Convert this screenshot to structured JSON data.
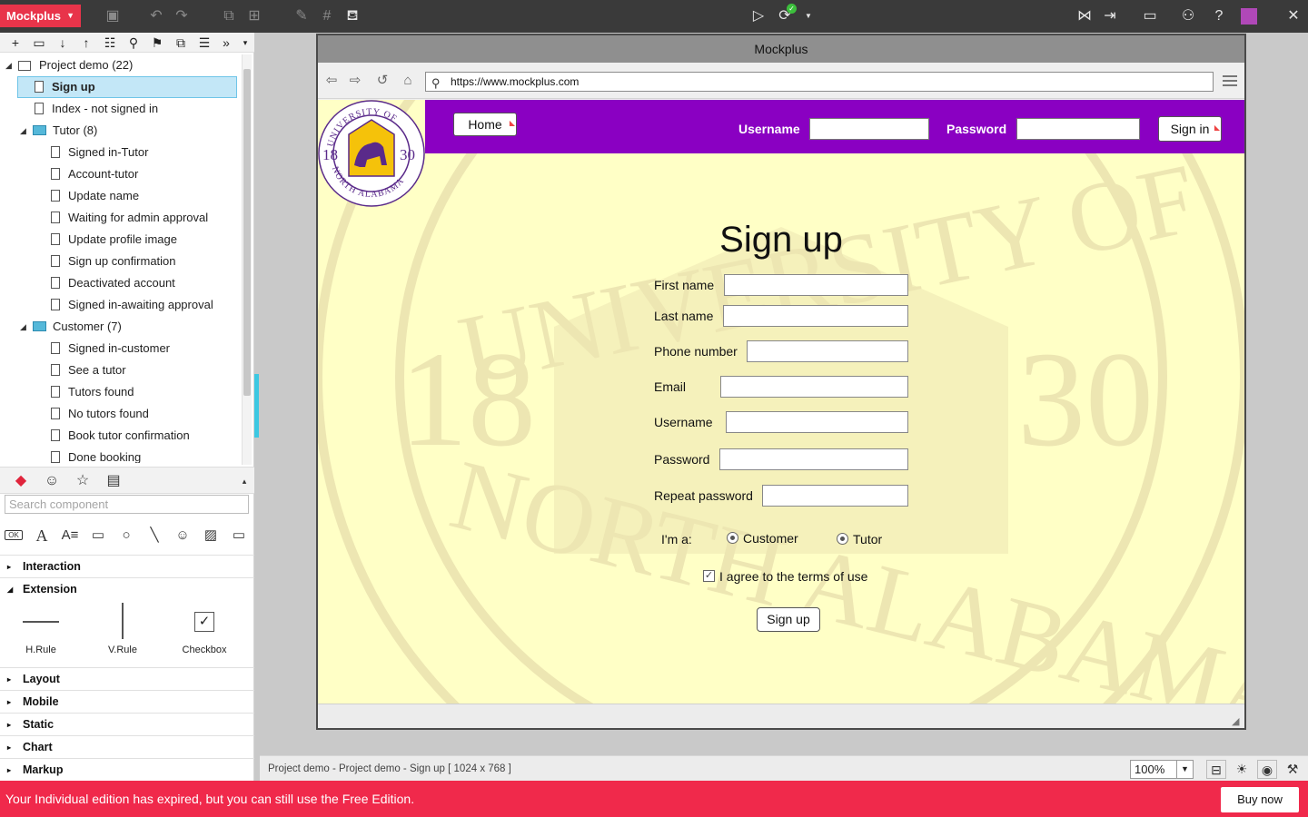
{
  "app": {
    "name": "Mockplus"
  },
  "tree": {
    "items": [
      {
        "label": "Project demo (22)",
        "kind": "project",
        "level": 0
      },
      {
        "label": "Sign up",
        "kind": "page",
        "level": 1,
        "selected": true
      },
      {
        "label": "Index - not signed in",
        "kind": "page",
        "level": 1
      },
      {
        "label": "Tutor (8)",
        "kind": "folder",
        "level": 1
      },
      {
        "label": "Signed in-Tutor",
        "kind": "page",
        "level": 2
      },
      {
        "label": "Account-tutor",
        "kind": "page",
        "level": 2
      },
      {
        "label": "Update name",
        "kind": "page",
        "level": 2
      },
      {
        "label": "Waiting for admin approval",
        "kind": "page",
        "level": 2
      },
      {
        "label": "Update profile image",
        "kind": "page",
        "level": 2
      },
      {
        "label": "Sign up confirmation",
        "kind": "page",
        "level": 2
      },
      {
        "label": "Deactivated account",
        "kind": "page",
        "level": 2
      },
      {
        "label": "Signed in-awaiting approval",
        "kind": "page",
        "level": 2
      },
      {
        "label": "Customer (7)",
        "kind": "folder",
        "level": 1
      },
      {
        "label": "Signed in-customer",
        "kind": "page",
        "level": 2
      },
      {
        "label": "See a tutor",
        "kind": "page",
        "level": 2
      },
      {
        "label": "Tutors found",
        "kind": "page",
        "level": 2
      },
      {
        "label": "No tutors found",
        "kind": "page",
        "level": 2
      },
      {
        "label": "Book tutor confirmation",
        "kind": "page",
        "level": 2
      },
      {
        "label": "Done booking",
        "kind": "page",
        "level": 2
      }
    ]
  },
  "components": {
    "search_placeholder": "Search component",
    "categories": {
      "interaction": "Interaction",
      "extension": "Extension",
      "layout": "Layout",
      "mobile": "Mobile",
      "static": "Static",
      "chart": "Chart",
      "markup": "Markup"
    },
    "extension_items": [
      "H.Rule",
      "V.Rule",
      "Checkbox"
    ]
  },
  "browser": {
    "title": "Mockplus",
    "url": "https://www.mockplus.com"
  },
  "page": {
    "home_label": "Home",
    "username_label": "Username",
    "password_label": "Password",
    "signin_label": "Sign in",
    "title": "Sign up",
    "fields": {
      "first_name": "First name",
      "last_name": "Last name",
      "phone": "Phone number",
      "email": "Email",
      "username": "Username",
      "password": "Password",
      "repeat_password": "Repeat password"
    },
    "role_label": "I'm a:",
    "role_options": [
      "Customer",
      "Tutor"
    ],
    "terms_label": "I agree to the terms of use",
    "submit_label": "Sign up",
    "logo": {
      "top": "UNIVERSITY OF",
      "bottom": "NORTH ALABAMA",
      "left_year": "18",
      "right_year": "30"
    }
  },
  "statusbar": {
    "path": "Project demo - Project demo - Sign up [ 1024 x 768 ]",
    "zoom": "100%"
  },
  "notice": {
    "text": "Your Individual edition has expired, but you can still use the Free Edition.",
    "buy_label": "Buy now"
  },
  "colors": {
    "brand": "#e8344a",
    "header_purple": "#8a00c2",
    "page_bg": "#ffffc6",
    "notice_bg": "#f0294b",
    "selection": "#c3e7f7"
  }
}
